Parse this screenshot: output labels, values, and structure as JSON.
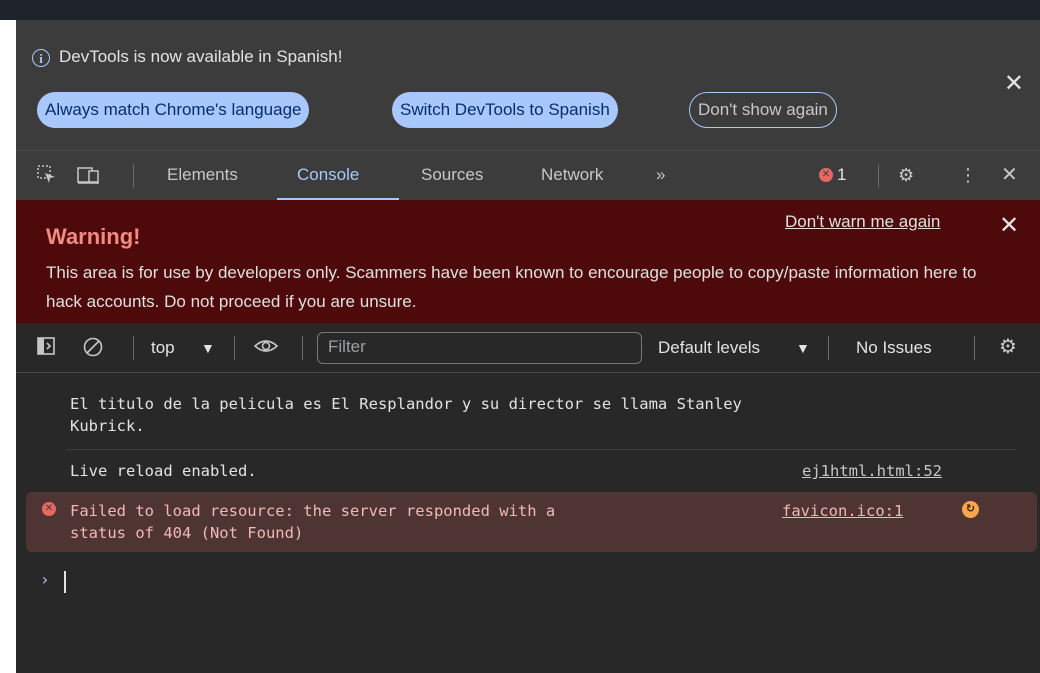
{
  "infobar": {
    "message": "DevTools is now available in Spanish!",
    "buttons": {
      "match": "Always match Chrome's language",
      "switch": "Switch DevTools to Spanish",
      "dismiss": "Don't show again"
    }
  },
  "tabs": [
    "Elements",
    "Console",
    "Sources",
    "Network"
  ],
  "active_tab": "Console",
  "error_count": "1",
  "warning": {
    "title": "Warning!",
    "body": "This area is for use by developers only. Scammers have been known to encourage people to copy/paste information here to hack accounts. Do not proceed if you are unsure.",
    "link": "Don't warn me again"
  },
  "console_toolbar": {
    "context": "top",
    "filter_placeholder": "Filter",
    "levels": "Default levels",
    "issues": "No Issues"
  },
  "messages": [
    {
      "text": "El titulo de la pelicula es El Resplandor y su director se llama Stanley\nKubrick.",
      "source": ""
    },
    {
      "text": "Live reload enabled.",
      "source": "ej1html.html:52"
    },
    {
      "text": "Failed to load resource: the server responded with a\nstatus of 404 (Not Found)",
      "source": "favicon.ico:1",
      "level": "error"
    }
  ],
  "colors": {
    "accent": "#a8c7fa",
    "error": "#e46962",
    "warning_bg": "#4e0a0a",
    "panel_bg": "#282828"
  }
}
